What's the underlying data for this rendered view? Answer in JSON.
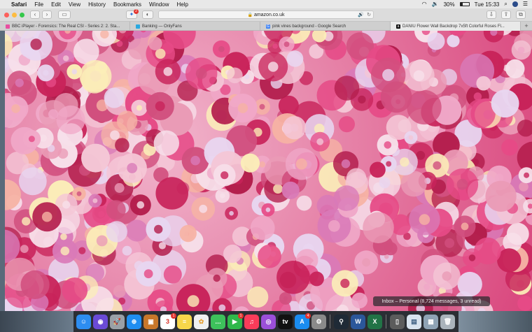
{
  "menubar": {
    "apple": "",
    "app_name": "Safari",
    "menus": [
      "File",
      "Edit",
      "View",
      "History",
      "Bookmarks",
      "Window",
      "Help"
    ],
    "battery": "30%",
    "clock": "Tue 15:33"
  },
  "toolbar": {
    "url": "amazon.co.uk",
    "extension_badge": "2"
  },
  "tabs": [
    {
      "title": "BBC iPlayer - Forensics: The Real CSI - Series 2: 2. Sta...",
      "favicon_color": "#e84fa0"
    },
    {
      "title": "Banking — OnlyFans",
      "favicon_color": "#2aa9e0"
    },
    {
      "title": "pink vines background - Google Search",
      "favicon_color": "#4285f4",
      "favicon_letter": "G"
    },
    {
      "title": "DANIU Flower Wall Backdrop 7x5ft Colorful Roses Fl...",
      "favicon_color": "#111111",
      "favicon_letter": "a",
      "active": true
    }
  ],
  "notification": "Inbox – Personal  (8,724 messages, 3 unread)",
  "dock": [
    {
      "name": "finder-icon",
      "glyph": "☺",
      "color": "#2d8df0"
    },
    {
      "name": "siri-icon",
      "glyph": "◉",
      "color": "#6a4ad6"
    },
    {
      "name": "launchpad-icon",
      "glyph": "🚀",
      "color": "#9aa0a6"
    },
    {
      "name": "safari-icon",
      "glyph": "⊕",
      "color": "#1f8ef1"
    },
    {
      "name": "photo-icon",
      "glyph": "▣",
      "color": "#c8772a"
    },
    {
      "name": "calendar-icon",
      "glyph": "3",
      "color": "#ffffff",
      "text_color": "#d93025",
      "badge": "1"
    },
    {
      "name": "notes-icon",
      "glyph": "≡",
      "color": "#f7d64a"
    },
    {
      "name": "photos-icon",
      "glyph": "✿",
      "color": "#f0f0f0",
      "text_color": "#e8a33a"
    },
    {
      "name": "messages-icon",
      "glyph": "…",
      "color": "#3dc15b"
    },
    {
      "name": "facetime-icon",
      "glyph": "▶",
      "color": "#2fb84a",
      "badge": "1"
    },
    {
      "name": "music-icon",
      "glyph": "♫",
      "color": "#fa3c5a"
    },
    {
      "name": "podcasts-icon",
      "glyph": "◎",
      "color": "#9b4fd9"
    },
    {
      "name": "appletv-icon",
      "glyph": "tv",
      "color": "#111111"
    },
    {
      "name": "appstore-icon",
      "glyph": "A",
      "color": "#1a8cf0",
      "badge": "4"
    },
    {
      "name": "settings-icon",
      "glyph": "⚙",
      "color": "#8a8a8a"
    },
    {
      "name": "sep",
      "glyph": ""
    },
    {
      "name": "vpn-icon",
      "glyph": "⚲",
      "color": "#1f2a36"
    },
    {
      "name": "word-icon",
      "glyph": "W",
      "color": "#2b579a"
    },
    {
      "name": "excel-icon",
      "glyph": "X",
      "color": "#217346"
    },
    {
      "name": "sep",
      "glyph": ""
    },
    {
      "name": "phone-icon",
      "glyph": "▯",
      "color": "#5c5c5c"
    },
    {
      "name": "preview-icon",
      "glyph": "▤",
      "color": "#d9e4ef",
      "text_color": "#3b5d80"
    },
    {
      "name": "screenshot-icon",
      "glyph": "▦",
      "color": "#8fa3b5"
    },
    {
      "name": "trash-icon",
      "glyph": "🗑",
      "color": "#aab3bb"
    }
  ]
}
